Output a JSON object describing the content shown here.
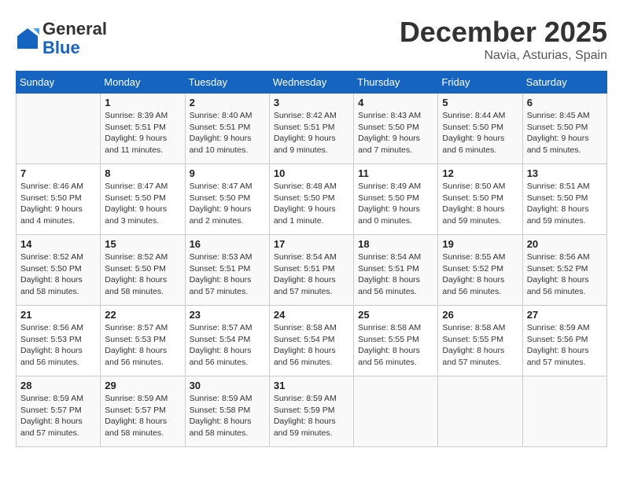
{
  "header": {
    "logo_line1": "General",
    "logo_line2": "Blue",
    "month": "December 2025",
    "location": "Navia, Asturias, Spain"
  },
  "weekdays": [
    "Sunday",
    "Monday",
    "Tuesday",
    "Wednesday",
    "Thursday",
    "Friday",
    "Saturday"
  ],
  "weeks": [
    [
      {
        "day": "",
        "info": ""
      },
      {
        "day": "1",
        "info": "Sunrise: 8:39 AM\nSunset: 5:51 PM\nDaylight: 9 hours\nand 11 minutes."
      },
      {
        "day": "2",
        "info": "Sunrise: 8:40 AM\nSunset: 5:51 PM\nDaylight: 9 hours\nand 10 minutes."
      },
      {
        "day": "3",
        "info": "Sunrise: 8:42 AM\nSunset: 5:51 PM\nDaylight: 9 hours\nand 9 minutes."
      },
      {
        "day": "4",
        "info": "Sunrise: 8:43 AM\nSunset: 5:50 PM\nDaylight: 9 hours\nand 7 minutes."
      },
      {
        "day": "5",
        "info": "Sunrise: 8:44 AM\nSunset: 5:50 PM\nDaylight: 9 hours\nand 6 minutes."
      },
      {
        "day": "6",
        "info": "Sunrise: 8:45 AM\nSunset: 5:50 PM\nDaylight: 9 hours\nand 5 minutes."
      }
    ],
    [
      {
        "day": "7",
        "info": "Sunrise: 8:46 AM\nSunset: 5:50 PM\nDaylight: 9 hours\nand 4 minutes."
      },
      {
        "day": "8",
        "info": "Sunrise: 8:47 AM\nSunset: 5:50 PM\nDaylight: 9 hours\nand 3 minutes."
      },
      {
        "day": "9",
        "info": "Sunrise: 8:47 AM\nSunset: 5:50 PM\nDaylight: 9 hours\nand 2 minutes."
      },
      {
        "day": "10",
        "info": "Sunrise: 8:48 AM\nSunset: 5:50 PM\nDaylight: 9 hours\nand 1 minute."
      },
      {
        "day": "11",
        "info": "Sunrise: 8:49 AM\nSunset: 5:50 PM\nDaylight: 9 hours\nand 0 minutes."
      },
      {
        "day": "12",
        "info": "Sunrise: 8:50 AM\nSunset: 5:50 PM\nDaylight: 8 hours\nand 59 minutes."
      },
      {
        "day": "13",
        "info": "Sunrise: 8:51 AM\nSunset: 5:50 PM\nDaylight: 8 hours\nand 59 minutes."
      }
    ],
    [
      {
        "day": "14",
        "info": "Sunrise: 8:52 AM\nSunset: 5:50 PM\nDaylight: 8 hours\nand 58 minutes."
      },
      {
        "day": "15",
        "info": "Sunrise: 8:52 AM\nSunset: 5:50 PM\nDaylight: 8 hours\nand 58 minutes."
      },
      {
        "day": "16",
        "info": "Sunrise: 8:53 AM\nSunset: 5:51 PM\nDaylight: 8 hours\nand 57 minutes."
      },
      {
        "day": "17",
        "info": "Sunrise: 8:54 AM\nSunset: 5:51 PM\nDaylight: 8 hours\nand 57 minutes."
      },
      {
        "day": "18",
        "info": "Sunrise: 8:54 AM\nSunset: 5:51 PM\nDaylight: 8 hours\nand 56 minutes."
      },
      {
        "day": "19",
        "info": "Sunrise: 8:55 AM\nSunset: 5:52 PM\nDaylight: 8 hours\nand 56 minutes."
      },
      {
        "day": "20",
        "info": "Sunrise: 8:56 AM\nSunset: 5:52 PM\nDaylight: 8 hours\nand 56 minutes."
      }
    ],
    [
      {
        "day": "21",
        "info": "Sunrise: 8:56 AM\nSunset: 5:53 PM\nDaylight: 8 hours\nand 56 minutes."
      },
      {
        "day": "22",
        "info": "Sunrise: 8:57 AM\nSunset: 5:53 PM\nDaylight: 8 hours\nand 56 minutes."
      },
      {
        "day": "23",
        "info": "Sunrise: 8:57 AM\nSunset: 5:54 PM\nDaylight: 8 hours\nand 56 minutes."
      },
      {
        "day": "24",
        "info": "Sunrise: 8:58 AM\nSunset: 5:54 PM\nDaylight: 8 hours\nand 56 minutes."
      },
      {
        "day": "25",
        "info": "Sunrise: 8:58 AM\nSunset: 5:55 PM\nDaylight: 8 hours\nand 56 minutes."
      },
      {
        "day": "26",
        "info": "Sunrise: 8:58 AM\nSunset: 5:55 PM\nDaylight: 8 hours\nand 57 minutes."
      },
      {
        "day": "27",
        "info": "Sunrise: 8:59 AM\nSunset: 5:56 PM\nDaylight: 8 hours\nand 57 minutes."
      }
    ],
    [
      {
        "day": "28",
        "info": "Sunrise: 8:59 AM\nSunset: 5:57 PM\nDaylight: 8 hours\nand 57 minutes."
      },
      {
        "day": "29",
        "info": "Sunrise: 8:59 AM\nSunset: 5:57 PM\nDaylight: 8 hours\nand 58 minutes."
      },
      {
        "day": "30",
        "info": "Sunrise: 8:59 AM\nSunset: 5:58 PM\nDaylight: 8 hours\nand 58 minutes."
      },
      {
        "day": "31",
        "info": "Sunrise: 8:59 AM\nSunset: 5:59 PM\nDaylight: 8 hours\nand 59 minutes."
      },
      {
        "day": "",
        "info": ""
      },
      {
        "day": "",
        "info": ""
      },
      {
        "day": "",
        "info": ""
      }
    ]
  ]
}
